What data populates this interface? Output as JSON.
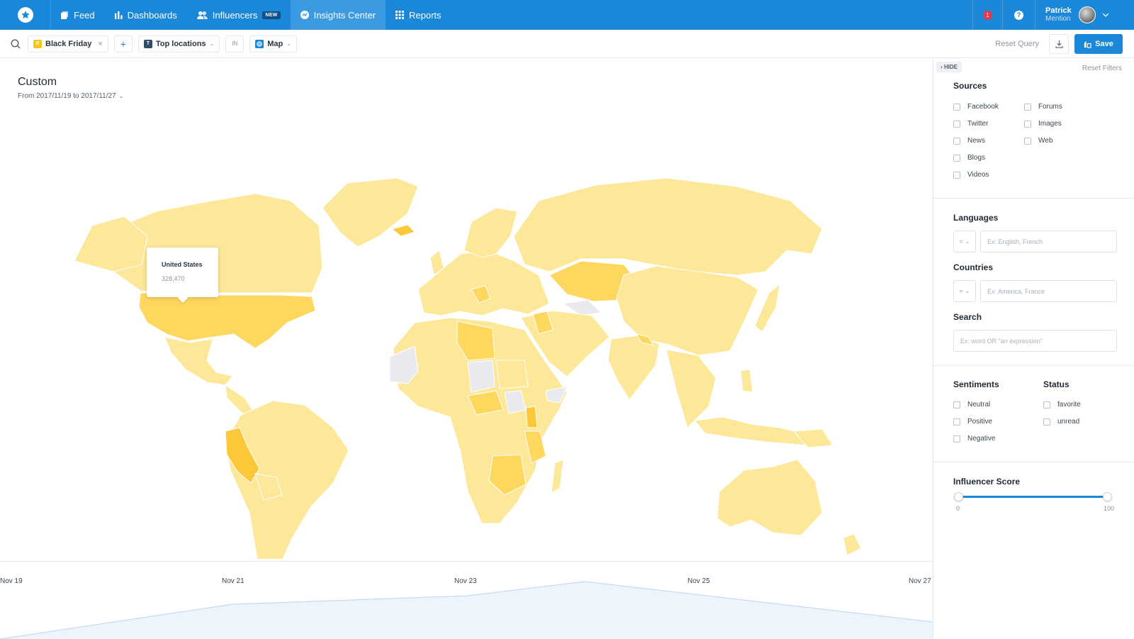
{
  "nav": {
    "items": [
      {
        "label": "Feed",
        "icon": "feed-icon"
      },
      {
        "label": "Dashboards",
        "icon": "bar-chart-icon"
      },
      {
        "label": "Influencers",
        "icon": "users-icon",
        "badge": "NEW"
      },
      {
        "label": "Insights Center",
        "icon": "insights-icon",
        "active": true
      },
      {
        "label": "Reports",
        "icon": "grid-icon"
      }
    ],
    "notifications": "1",
    "help": "?",
    "user": {
      "first": "Patrick",
      "last": "Mention"
    }
  },
  "query": {
    "alert_chip": {
      "letter": "B",
      "label": "Black Friday",
      "color": "#f5c518"
    },
    "plus": "+",
    "view_chip": {
      "letter": "T",
      "label": "Top locations",
      "color": "#2f4b66"
    },
    "in_label": "IN",
    "type_chip": {
      "label": "Map",
      "color": "#1a87d8"
    },
    "reset_query": "Reset Query",
    "save": "Save"
  },
  "main": {
    "title": "Custom",
    "date_range": "From 2017/11/19 to 2017/11/27"
  },
  "tooltip": {
    "country": "United States",
    "value": "328,470"
  },
  "timeline": {
    "labels": [
      "Nov 19",
      "Nov 21",
      "Nov 23",
      "Nov 25",
      "Nov 27"
    ]
  },
  "colors": {
    "primary": "#1a87d8",
    "map_light": "#fde89a",
    "map_mid": "#fdd75e",
    "map_strong": "#fcc83a",
    "map_nodata": "#e9eaed"
  },
  "filters": {
    "hide": "› HIDE",
    "reset_filters": "Reset Filters",
    "sources": {
      "title": "Sources",
      "col1": [
        "Facebook",
        "Twitter",
        "News",
        "Blogs",
        "Videos"
      ],
      "col2": [
        "Forums",
        "Images",
        "Web"
      ]
    },
    "languages": {
      "title": "Languages",
      "operator": "=",
      "placeholder": "Ex: English, French"
    },
    "countries": {
      "title": "Countries",
      "operator": "=",
      "placeholder": "Ex: America, France"
    },
    "search": {
      "title": "Search",
      "placeholder": "Ex: word OR \"an expression\""
    },
    "sentiments": {
      "title": "Sentiments",
      "items": [
        "Neutral",
        "Positive",
        "Negative"
      ]
    },
    "status": {
      "title": "Status",
      "items": [
        "favorite",
        "unread"
      ]
    },
    "influencer_score": {
      "title": "Influencer Score",
      "min": "0",
      "max": "100"
    }
  }
}
